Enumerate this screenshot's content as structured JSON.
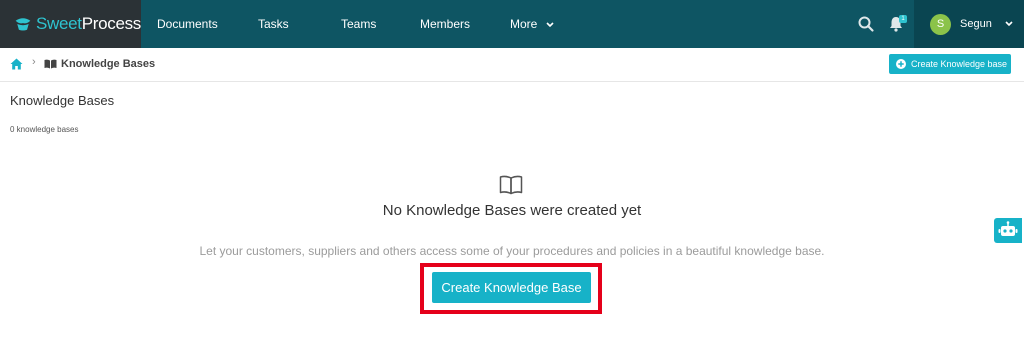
{
  "brand": {
    "logo_part1": "Sweet",
    "logo_part2": "Process"
  },
  "nav": {
    "items": [
      {
        "label": "Documents"
      },
      {
        "label": "Tasks"
      },
      {
        "label": "Teams"
      },
      {
        "label": "Members"
      },
      {
        "label": "More"
      }
    ],
    "notification_count": "1",
    "user": {
      "initial": "S",
      "name": "Segun"
    }
  },
  "breadcrumb": {
    "current": "Knowledge Bases",
    "separator": "›"
  },
  "header_button": {
    "label": "Create Knowledge base"
  },
  "page": {
    "title": "Knowledge Bases",
    "count_text": "0 knowledge bases"
  },
  "empty_state": {
    "title": "No Knowledge Bases were created yet",
    "description": "Let your customers, suppliers and others access some of your procedures and policies in a beautiful knowledge base.",
    "button_label": "Create Knowledge Base"
  },
  "colors": {
    "nav_bg": "#0e5563",
    "logo_bg": "#2b3236",
    "accent": "#17b2c8",
    "highlight": "#e5001a",
    "avatar": "#8bc34a"
  },
  "icons": [
    "cup-logo-icon",
    "chevron-down-icon",
    "search-icon",
    "bell-icon",
    "home-icon",
    "book-icon",
    "plus-circle-icon",
    "robot-icon"
  ]
}
